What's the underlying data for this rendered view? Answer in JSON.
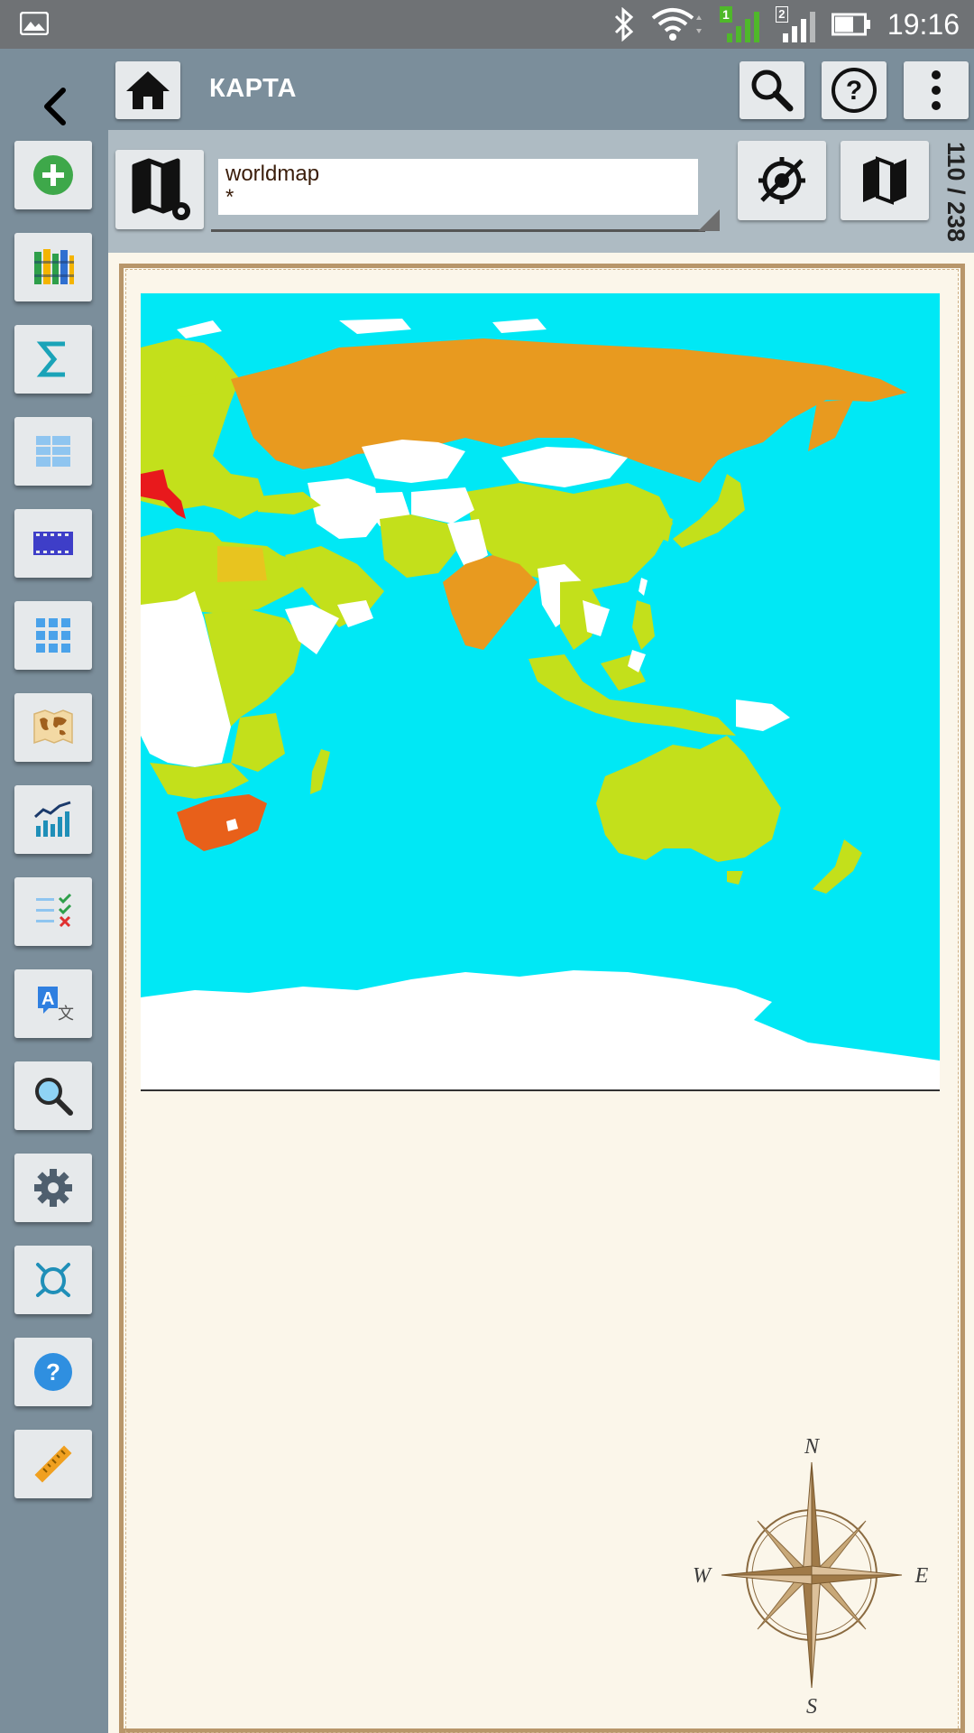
{
  "status_bar": {
    "time": "19:16",
    "sim1_label": "1",
    "sim2_label": "2",
    "icons": [
      "gallery-icon",
      "bluetooth-icon",
      "wifi-icon",
      "signal-icon",
      "signal-icon",
      "battery-icon"
    ]
  },
  "app_bar": {
    "title": "КАРТА",
    "icons": [
      "home-icon",
      "search-icon",
      "help-icon",
      "overflow-menu-icon"
    ]
  },
  "toolbar": {
    "map_name": "worldmap",
    "map_filter": "*",
    "counter": "110 / 238",
    "icons": [
      "map-settings-icon",
      "location-off-icon",
      "map-icon"
    ]
  },
  "sidebar": {
    "items": [
      {
        "name": "add",
        "icon": "add-circle-icon",
        "color": "#3ea84a"
      },
      {
        "name": "library",
        "icon": "books-icon"
      },
      {
        "name": "sum",
        "icon": "sigma-icon",
        "color": "#1aa3b8"
      },
      {
        "name": "table",
        "icon": "table-icon",
        "color": "#8fc5f0"
      },
      {
        "name": "film",
        "icon": "film-strip-icon",
        "color": "#3e3ec8"
      },
      {
        "name": "grid",
        "icon": "grid-icon",
        "color": "#4aa2ea"
      },
      {
        "name": "world-map",
        "icon": "world-map-icon"
      },
      {
        "name": "statistics",
        "icon": "bar-chart-icon",
        "color": "#1f8fb8"
      },
      {
        "name": "checklist",
        "icon": "checklist-icon"
      },
      {
        "name": "translate",
        "icon": "translate-icon",
        "color": "#2f7fe0"
      },
      {
        "name": "search",
        "icon": "magnifier-icon"
      },
      {
        "name": "settings",
        "icon": "gear-icon",
        "color": "#4f5f6e"
      },
      {
        "name": "bug",
        "icon": "bug-icon",
        "color": "#1f8fb8"
      },
      {
        "name": "help",
        "icon": "help-circle-icon",
        "color": "#2f8fe0"
      },
      {
        "name": "ruler",
        "icon": "ruler-icon",
        "color": "#f0a020"
      }
    ]
  },
  "map": {
    "colors": {
      "ocean": "#00e8f5",
      "high": "#e89a1f",
      "medium": "#c3e01b",
      "low": "#ffffff",
      "alt": "#e8601a",
      "highlight": "#e8191c"
    }
  },
  "compass": {
    "north": "N",
    "south": "S",
    "east": "E",
    "west": "W"
  },
  "colors": {
    "rail_bg": "#7b8e9b",
    "toolbar_bg": "#aebbc3",
    "parchment": "#fbf6ea",
    "frame": "#b8966a"
  }
}
